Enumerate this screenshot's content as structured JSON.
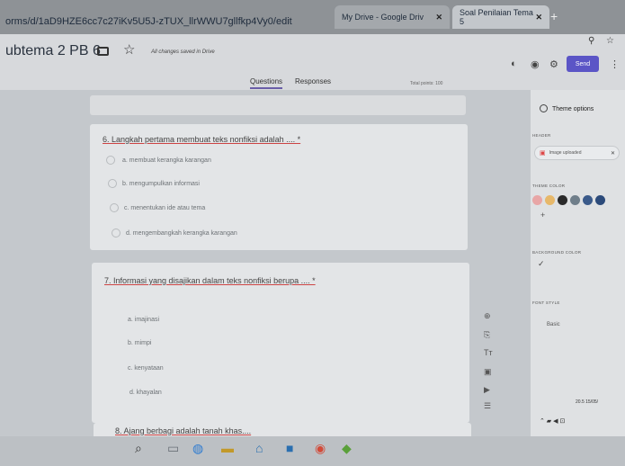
{
  "browser": {
    "url": "orms/d/1aD9HZE6cc7c27iKv5U5J-zTUX_llrWWU7gllfkp4Vy0/edit",
    "tabs": [
      {
        "label": "My Drive - Google Driv"
      },
      {
        "label": "Soal Penilaian Tema 5"
      }
    ],
    "newtab": "+"
  },
  "header": {
    "title": "ubtema 2 PB 6",
    "saved_text": "All changes saved in Drive",
    "send_label": "Send",
    "tabs": {
      "questions": "Questions",
      "responses": "Responses"
    },
    "total_points": "Total points: 100"
  },
  "questions": [
    {
      "title": "6. Langkah pertama membuat teks nonfiksi adalah .... *",
      "options": [
        "a. membuat kerangka karangan",
        "b. mengumpulkan informasi",
        "c. menentukan ide atau tema",
        "d. mengembangkah kerangka karangan"
      ]
    },
    {
      "title": "7. Informasi yang disajikan dalam teks nonfiksi berupa .... *",
      "options": [
        "a. imajinasi",
        "b. mimpi",
        "c. kenyataan",
        "d. khayalan"
      ]
    },
    {
      "title": "8. Ajang berbagi adalah tanah khas....",
      "options": []
    }
  ],
  "toolbar_icons": [
    "add-question-icon",
    "import-questions-icon",
    "add-title-icon",
    "add-image-icon",
    "add-video-icon",
    "add-section-icon"
  ],
  "theme": {
    "title": "Theme options",
    "header_label": "HEADER",
    "image_chip": "Image uploaded",
    "theme_color_label": "THEME COLOR",
    "swatch_colors": [
      "#e8a6a6",
      "#e7b86a",
      "#2a2a2a",
      "#6f7e8a",
      "#3a5a8a",
      "#2b4a7a"
    ],
    "bg_label": "BACKGROUND COLOR",
    "font_label": "FONT STYLE",
    "font_value": "Basic"
  },
  "taskbar": {
    "clock": "20.5\n15/05/"
  }
}
